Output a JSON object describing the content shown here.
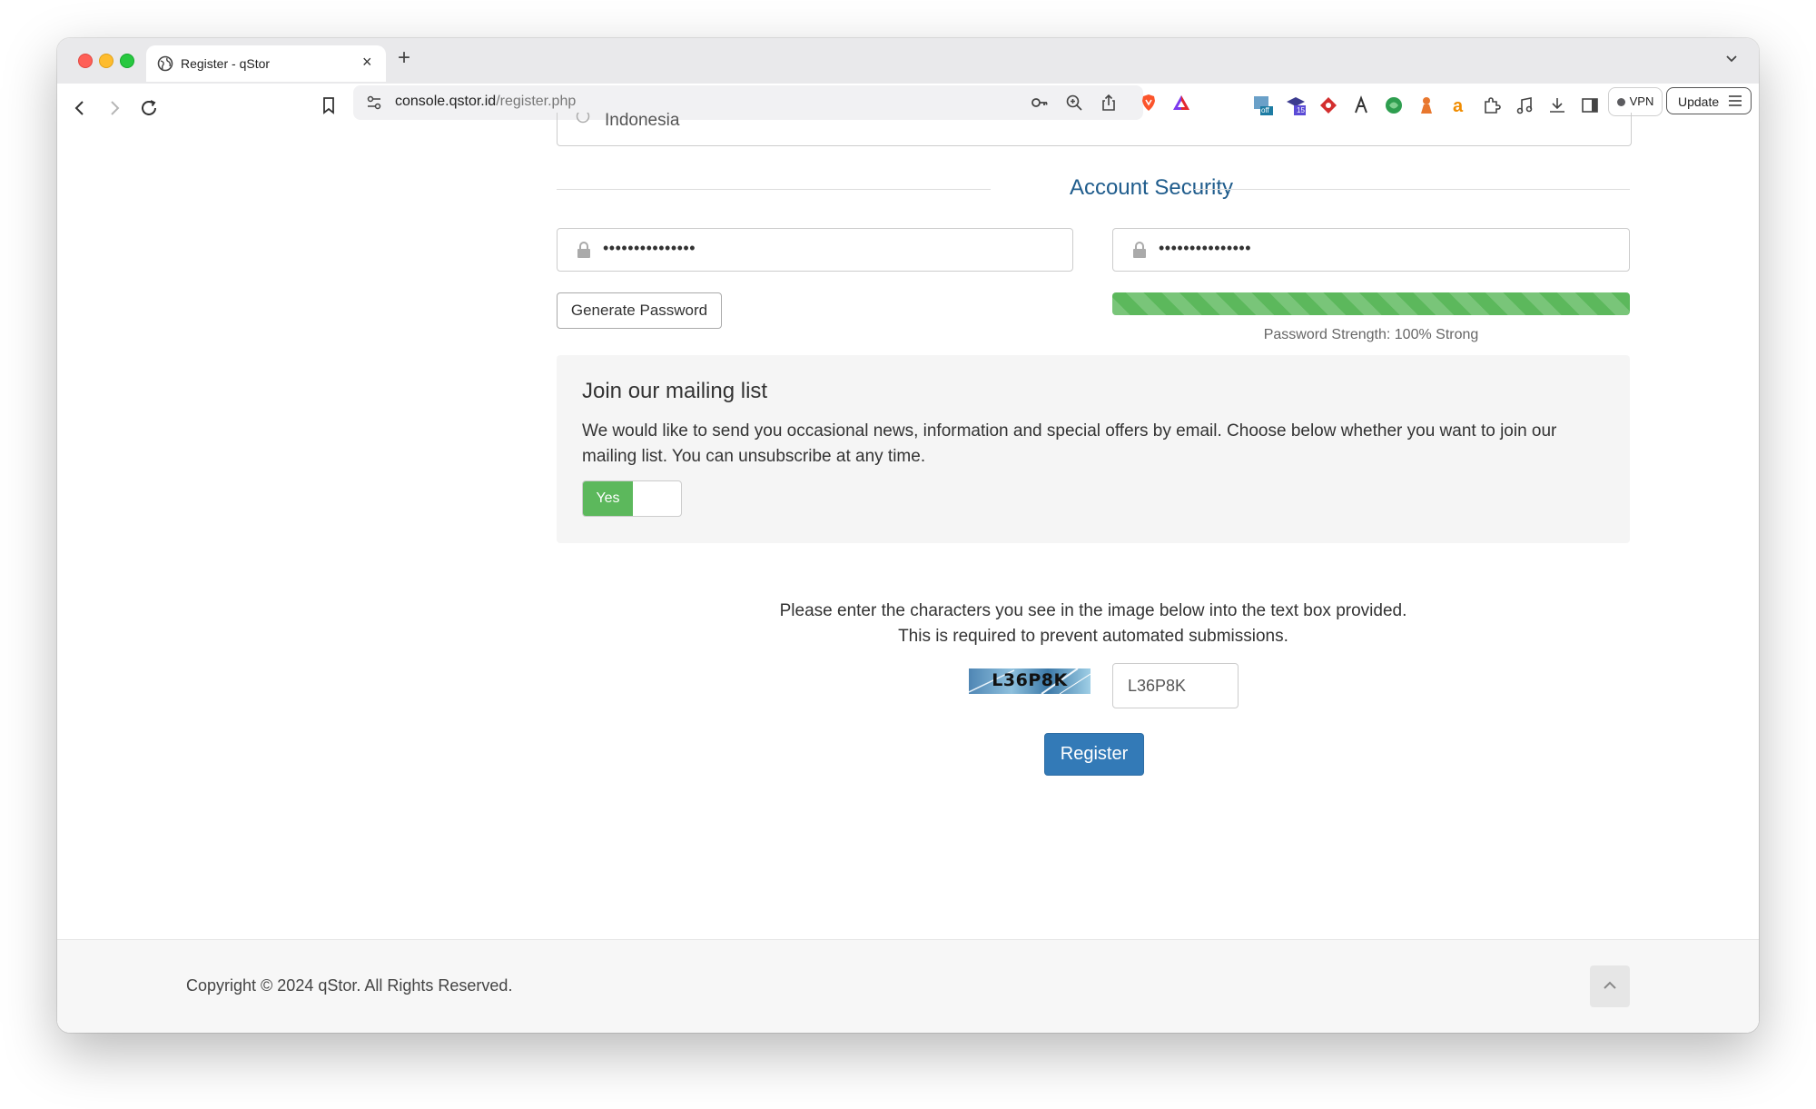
{
  "browser": {
    "tab_title": "Register - qStor",
    "new_tab_symbol": "+",
    "close_symbol": "×",
    "url_domain": "console.qstor.id",
    "url_path": "/register.php",
    "vpn_label": "VPN",
    "update_label": "Update",
    "extension_badges": {
      "first": "off",
      "second": "15"
    }
  },
  "form": {
    "country_value": "Indonesia",
    "section_title": "Account Security",
    "password_mask": "•••••••••••••••",
    "confirm_mask": "•••••••••••••••",
    "generate_label": "Generate Password",
    "strength_percent": 100,
    "strength_text": "Password Strength: 100% Strong",
    "strength_color": "#5cb85c"
  },
  "mailing": {
    "title": "Join our mailing list",
    "description": "We would like to send you occasional news, information and special offers by email. Choose below whether you want to join our mailing list. You can unsubscribe at any time.",
    "toggle_label": "Yes",
    "toggle_state": "on"
  },
  "captcha": {
    "line1": "Please enter the characters you see in the image below into the text box provided.",
    "line2": "This is required to prevent automated submissions.",
    "image_code": "L36P8K",
    "input_value": "L36P8K"
  },
  "register_label": "Register",
  "footer": {
    "copyright": "Copyright © 2024 qStor. All Rights Reserved."
  },
  "colors": {
    "primary": "#337ab7",
    "heading": "#1f5c8c",
    "success": "#5cb85c"
  }
}
